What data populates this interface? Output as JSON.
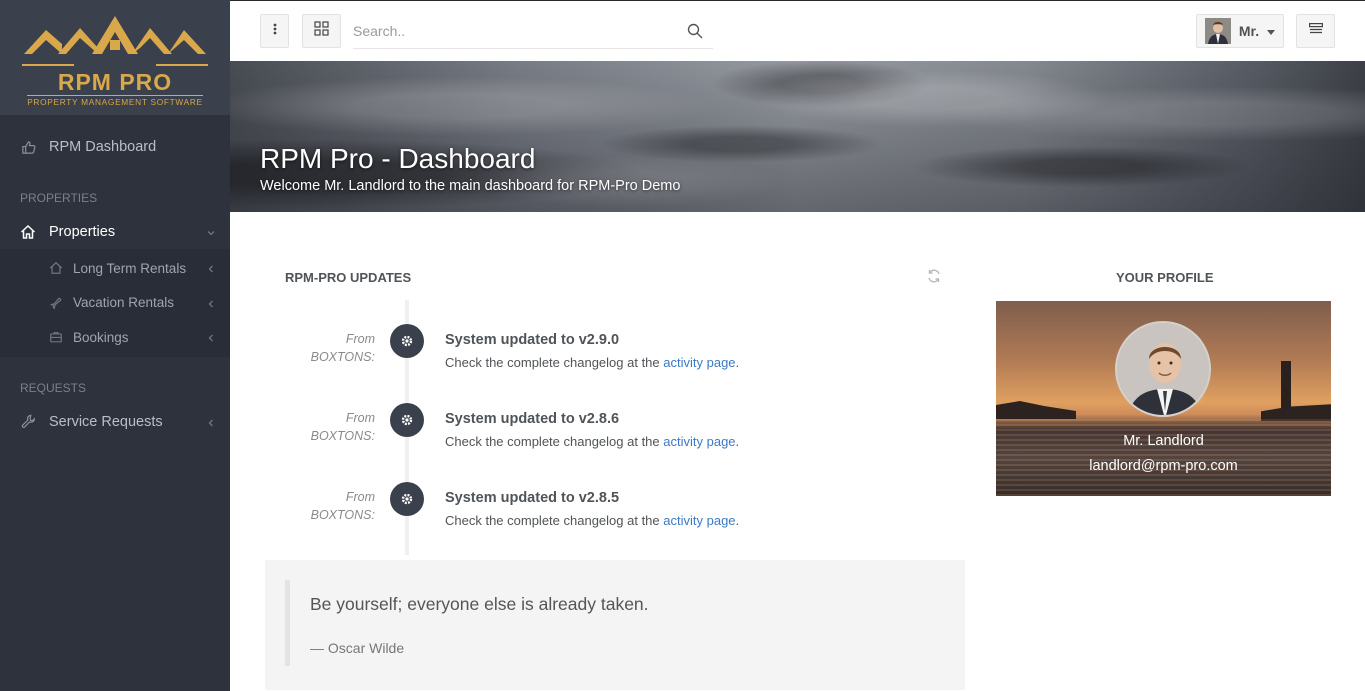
{
  "brand": {
    "logo_text": "RPM PRO",
    "logo_subtitle": "PROPERTY MANAGEMENT SOFTWARE",
    "gold": "#d8a84a"
  },
  "sidebar": {
    "dashboard": {
      "label": "RPM Dashboard",
      "icon": "thumbs-up-icon"
    },
    "section_properties": "PROPERTIES",
    "properties": {
      "label": "Properties",
      "icon": "home-icon"
    },
    "sub_items": [
      {
        "label": "Long Term Rentals",
        "icon": "home-outline-icon"
      },
      {
        "label": "Vacation Rentals",
        "icon": "plane-icon"
      },
      {
        "label": "Bookings",
        "icon": "briefcase-icon"
      }
    ],
    "section_requests": "REQUESTS",
    "service_requests": {
      "label": "Service Requests",
      "icon": "wrench-icon"
    }
  },
  "topbar": {
    "search_placeholder": "Search..",
    "user_label": "Mr."
  },
  "hero": {
    "title": "RPM Pro - Dashboard",
    "subtitle": "Welcome Mr. Landlord to the main dashboard for RPM-Pro Demo"
  },
  "updates": {
    "title": "RPM-PRO UPDATES",
    "items": [
      {
        "from": "From",
        "source": "BOXTONS:",
        "title": "System updated to v2.9.0",
        "body": "Check the complete changelog at the",
        "link": "activity page",
        "tail": "."
      },
      {
        "from": "From",
        "source": "BOXTONS:",
        "title": "System updated to v2.8.6",
        "body": "Check the complete changelog at the",
        "link": "activity page",
        "tail": "."
      },
      {
        "from": "From",
        "source": "BOXTONS:",
        "title": "System updated to v2.8.5",
        "body": "Check the complete changelog at the",
        "link": "activity page",
        "tail": "."
      }
    ]
  },
  "quote": {
    "text": "Be yourself; everyone else is already taken.",
    "author": "— Oscar Wilde"
  },
  "profile": {
    "title": "YOUR PROFILE",
    "name": "Mr. Landlord",
    "email": "landlord@rpm-pro.com"
  }
}
